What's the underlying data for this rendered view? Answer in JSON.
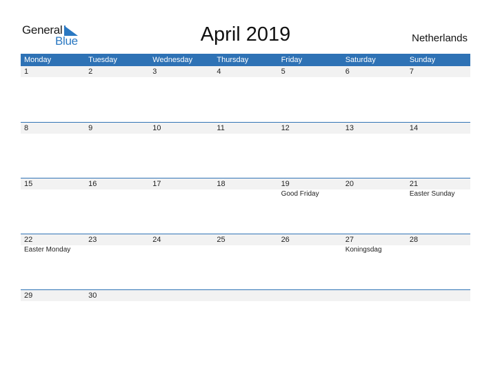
{
  "logo": {
    "general": "General",
    "blue": "Blue"
  },
  "title": "April 2019",
  "country": "Netherlands",
  "colors": {
    "accent": "#2e72b5",
    "date_bar": "#f2f2f2"
  },
  "weekdays": [
    "Monday",
    "Tuesday",
    "Wednesday",
    "Thursday",
    "Friday",
    "Saturday",
    "Sunday"
  ],
  "weeks": [
    [
      {
        "d": "1",
        "h": ""
      },
      {
        "d": "2",
        "h": ""
      },
      {
        "d": "3",
        "h": ""
      },
      {
        "d": "4",
        "h": ""
      },
      {
        "d": "5",
        "h": ""
      },
      {
        "d": "6",
        "h": ""
      },
      {
        "d": "7",
        "h": ""
      }
    ],
    [
      {
        "d": "8",
        "h": ""
      },
      {
        "d": "9",
        "h": ""
      },
      {
        "d": "10",
        "h": ""
      },
      {
        "d": "11",
        "h": ""
      },
      {
        "d": "12",
        "h": ""
      },
      {
        "d": "13",
        "h": ""
      },
      {
        "d": "14",
        "h": ""
      }
    ],
    [
      {
        "d": "15",
        "h": ""
      },
      {
        "d": "16",
        "h": ""
      },
      {
        "d": "17",
        "h": ""
      },
      {
        "d": "18",
        "h": ""
      },
      {
        "d": "19",
        "h": "Good Friday"
      },
      {
        "d": "20",
        "h": ""
      },
      {
        "d": "21",
        "h": "Easter Sunday"
      }
    ],
    [
      {
        "d": "22",
        "h": "Easter Monday"
      },
      {
        "d": "23",
        "h": ""
      },
      {
        "d": "24",
        "h": ""
      },
      {
        "d": "25",
        "h": ""
      },
      {
        "d": "26",
        "h": ""
      },
      {
        "d": "27",
        "h": "Koningsdag"
      },
      {
        "d": "28",
        "h": ""
      }
    ],
    [
      {
        "d": "29",
        "h": ""
      },
      {
        "d": "30",
        "h": ""
      },
      {
        "d": "",
        "h": ""
      },
      {
        "d": "",
        "h": ""
      },
      {
        "d": "",
        "h": ""
      },
      {
        "d": "",
        "h": ""
      },
      {
        "d": "",
        "h": ""
      }
    ]
  ]
}
